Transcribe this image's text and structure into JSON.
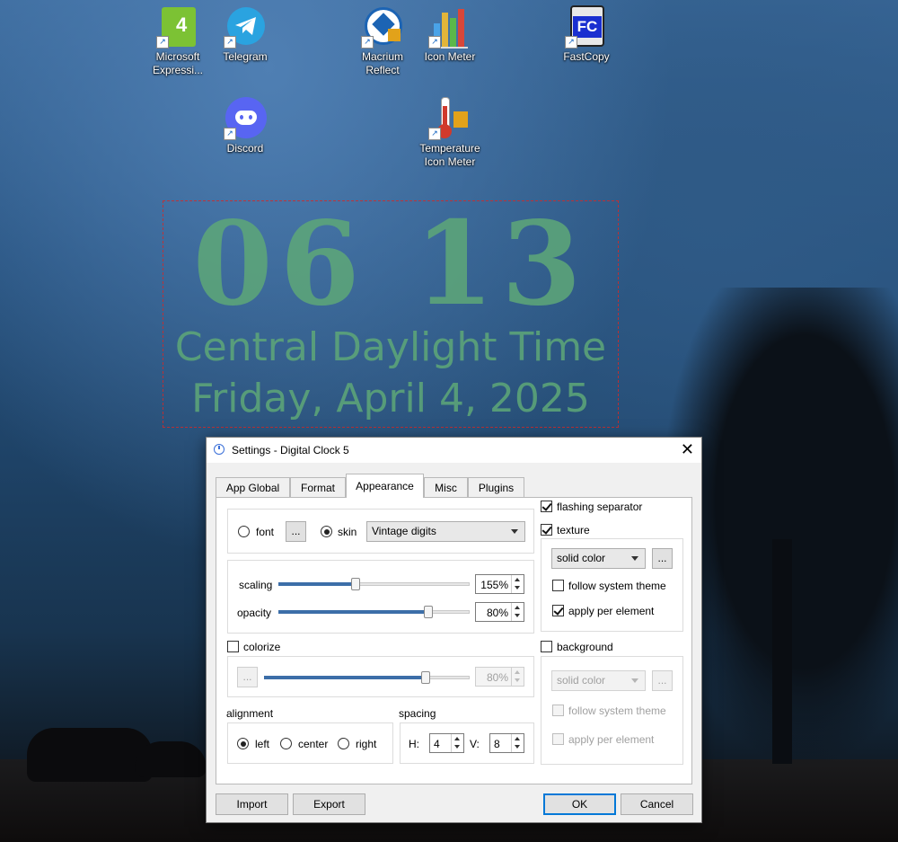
{
  "desktop": {
    "icons": [
      {
        "label": "Microsoft Expressi...",
        "icon": "expression-studio-icon",
        "color": "#6fae2b"
      },
      {
        "label": "Telegram",
        "icon": "telegram-icon",
        "color": "#2aa3e0"
      },
      {
        "label": "Macrium Reflect",
        "icon": "macrium-reflect-icon",
        "color": "#1c64b4"
      },
      {
        "label": "Icon Meter",
        "icon": "bar-chart-icon",
        "color": "#e2b53a"
      },
      {
        "label": "FastCopy",
        "icon": "fastcopy-icon",
        "color": "#1a2fd0"
      },
      {
        "label": "Discord",
        "icon": "discord-icon",
        "color": "#5865f2"
      },
      {
        "label": "Temperature Icon Meter",
        "icon": "thermometer-icon",
        "color": "#d03a2c"
      }
    ]
  },
  "clock": {
    "time": "06 13",
    "timezone": "Central Daylight Time",
    "date": "Friday, April 4, 2025",
    "color": "#5ea878"
  },
  "dialog": {
    "title": "Settings - Digital Clock 5",
    "tabs": [
      "App Global",
      "Format",
      "Appearance",
      "Misc",
      "Plugins"
    ],
    "active_tab": "Appearance",
    "source": {
      "font_label": "font",
      "font_browse": "...",
      "skin_label": "skin",
      "skin_value": "Vintage digits",
      "selected": "skin"
    },
    "scaling": {
      "label": "scaling",
      "value": "155%",
      "level": 0.4
    },
    "opacity": {
      "label": "opacity",
      "value": "80%",
      "level": 0.8
    },
    "colorize": {
      "label": "colorize",
      "checked": false,
      "browse": "...",
      "value": "80%",
      "level": 0.8
    },
    "alignment": {
      "label": "alignment",
      "options": [
        "left",
        "center",
        "right"
      ],
      "selected": "left"
    },
    "spacing": {
      "label": "spacing",
      "h_label": "H:",
      "h_value": "4",
      "v_label": "V:",
      "v_value": "8"
    },
    "flashing_separator": {
      "label": "flashing separator",
      "checked": true
    },
    "texture": {
      "label": "texture",
      "checked": true,
      "mode": "solid color",
      "browse": "...",
      "follow_theme": {
        "label": "follow system theme",
        "checked": false
      },
      "per_element": {
        "label": "apply per element",
        "checked": true
      }
    },
    "background": {
      "label": "background",
      "checked": false,
      "mode": "solid color",
      "browse": "...",
      "follow_theme": {
        "label": "follow system theme",
        "checked": false
      },
      "per_element": {
        "label": "apply per element",
        "checked": false
      }
    },
    "buttons": {
      "import": "Import",
      "export": "Export",
      "ok": "OK",
      "cancel": "Cancel"
    },
    "close_glyph": "✕"
  }
}
